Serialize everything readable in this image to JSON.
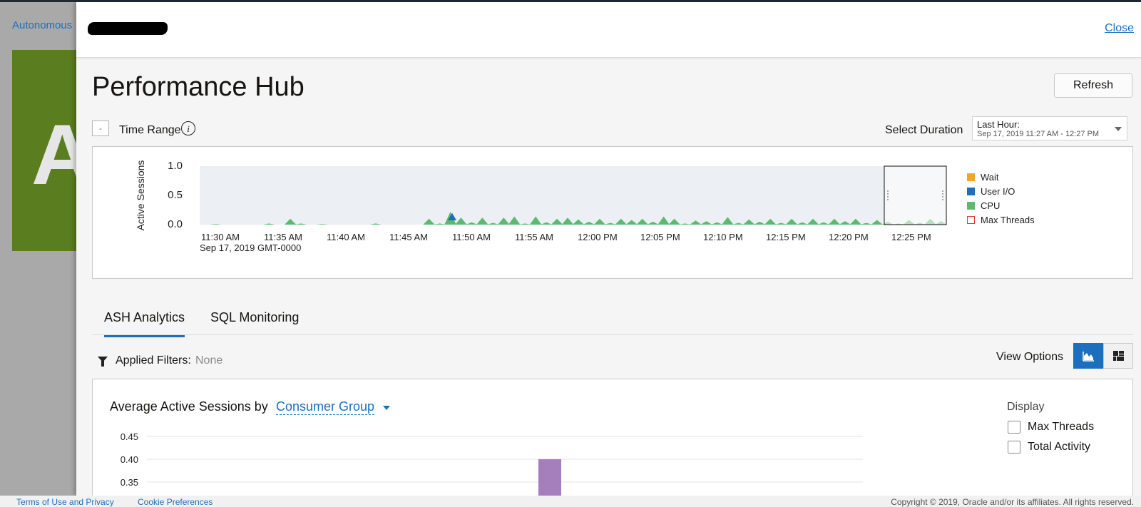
{
  "background": {
    "link_text": "Autonomous",
    "tile_letter": "A",
    "footer": {
      "terms": "Terms of Use and Privacy",
      "cookies": "Cookie Preferences",
      "copyright": "Copyright © 2019, Oracle and/or its affiliates. All rights reserved."
    }
  },
  "panel": {
    "close_label": "Close",
    "title": "Performance Hub",
    "refresh_label": "Refresh",
    "collapse_label": "-",
    "time_range_label": "Time Range",
    "info_glyph": "i",
    "select_duration_label": "Select Duration",
    "duration": {
      "value": "Last Hour:",
      "detail": "Sep 17, 2019 11:27 AM - 12:27 PM"
    }
  },
  "timeline_chart": {
    "type": "area",
    "ylabel": "Active Sessions",
    "yticks": [
      "1.0",
      "0.5",
      "0.0"
    ],
    "ylim": [
      0,
      1.0
    ],
    "xticks": [
      "11:30 AM",
      "11:35 AM",
      "11:40 AM",
      "11:45 AM",
      "11:50 AM",
      "11:55 AM",
      "12:00 PM",
      "12:05 PM",
      "12:10 PM",
      "12:15 PM",
      "12:20 PM",
      "12:25 PM"
    ],
    "xsublabel": "Sep 17, 2019 GMT-0000",
    "legend_position": "right",
    "legend": [
      {
        "name": "Wait",
        "color": "#f5a623",
        "style": "filled"
      },
      {
        "name": "User I/O",
        "color": "#1a6fbf",
        "style": "filled"
      },
      {
        "name": "CPU",
        "color": "#5cb96f",
        "style": "filled"
      },
      {
        "name": "Max Threads",
        "color": "#e53935",
        "style": "outline"
      }
    ],
    "cpu_spikes": [
      0.0,
      0.01,
      0.0,
      0.0,
      0.0,
      0.0,
      0.02,
      0.0,
      0.1,
      0.02,
      0.0,
      0.01,
      0.0,
      0.0,
      0.0,
      0.0,
      0.02,
      0.0,
      0.0,
      0.0,
      0.0,
      0.1,
      0.02,
      0.22,
      0.12,
      0.04,
      0.12,
      0.03,
      0.12,
      0.14,
      0.02,
      0.14,
      0.04,
      0.1,
      0.12,
      0.09,
      0.05,
      0.1,
      0.03,
      0.1,
      0.08,
      0.1,
      0.05,
      0.14,
      0.1,
      0.02,
      0.07,
      0.06,
      0.04,
      0.13,
      0.03,
      0.09,
      0.05,
      0.1,
      0.03,
      0.1,
      0.04,
      0.1,
      0.04,
      0.1,
      0.06,
      0.1,
      0.03,
      0.08,
      0.05,
      0.02,
      0.08,
      0.03,
      0.1,
      0.06
    ],
    "userio_spike": {
      "at": "11:50 AM",
      "value": 0.2
    }
  },
  "tabs": [
    {
      "label": "ASH Analytics",
      "active": true
    },
    {
      "label": "SQL Monitoring",
      "active": false
    }
  ],
  "filters": {
    "label": "Applied Filters:",
    "value": "None"
  },
  "view_options": {
    "label": "View Options",
    "buttons": [
      {
        "icon": "area-chart-icon",
        "active": true
      },
      {
        "icon": "treemap-icon",
        "active": false
      }
    ]
  },
  "aas": {
    "title": "Average Active Sessions by",
    "dimension": "Consumer Group",
    "display_label": "Display",
    "options": [
      {
        "label": "Max Threads",
        "checked": false
      },
      {
        "label": "Total Activity",
        "checked": false
      }
    ]
  },
  "chart_data": {
    "type": "bar",
    "yticks": [
      "0.45",
      "0.40",
      "0.35"
    ],
    "ylim": [
      0.35,
      0.45
    ],
    "bars": [
      {
        "value": 0.4,
        "color": "#a57fbc"
      }
    ]
  }
}
